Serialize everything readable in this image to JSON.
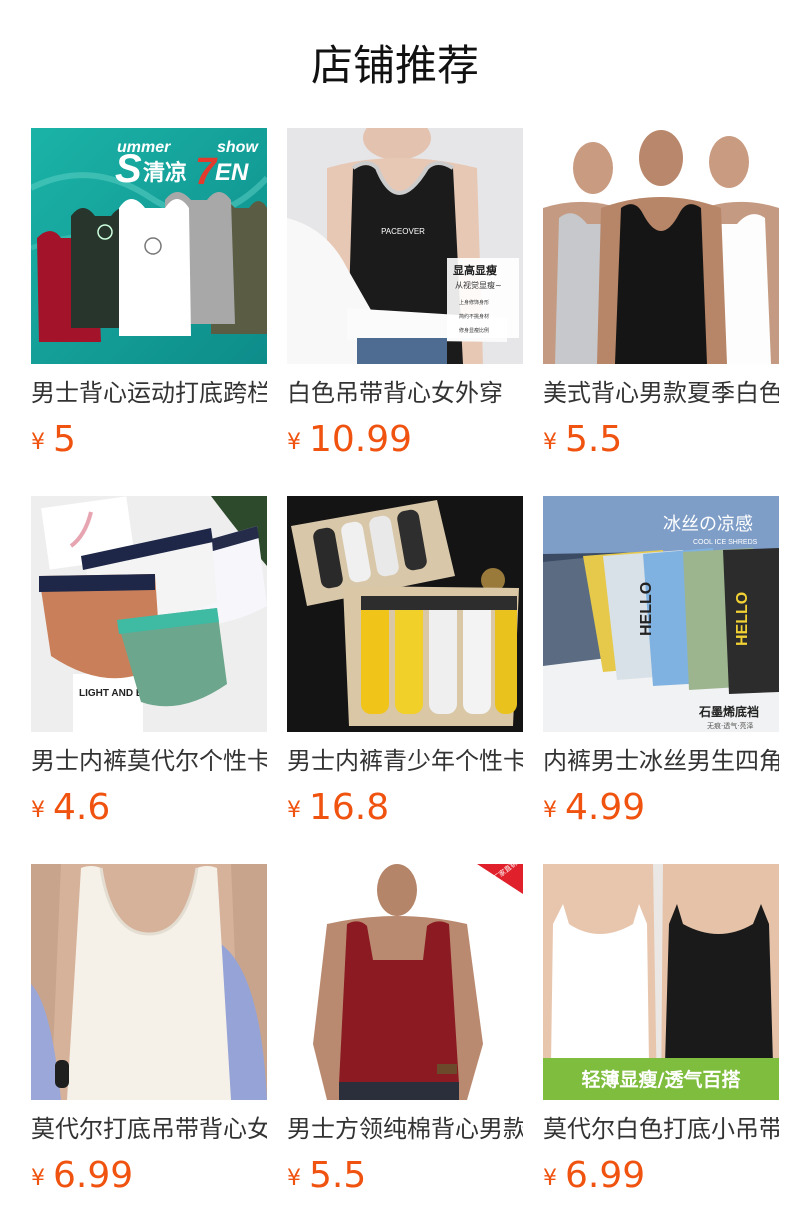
{
  "section_title": "店铺推荐",
  "currency_symbol": "¥",
  "accent_color": "#f0530f",
  "products": [
    {
      "name": "男士背心运动打底跨栏",
      "price": "5",
      "image_icon": "product-image-mens-tanks-banner",
      "image_text": {
        "top": "ummer",
        "show": "show",
        "s": "S",
        "cn": "清凉",
        "seven": "7",
        "en": "EN"
      }
    },
    {
      "name": "白色吊带背心女外穿",
      "price": "10.99",
      "image_icon": "product-image-womens-black-tank",
      "image_text": {
        "brand": "PACEOVER",
        "tag_title": "显高显瘦",
        "tag_sub": "从视觉显瘦~",
        "line1": "上身修饰身形",
        "line2": "简约不挑身材",
        "line3": "修身显瘦比例"
      }
    },
    {
      "name": "美式背心男款夏季白色",
      "price": "5.5",
      "image_icon": "product-image-three-men-tanks"
    },
    {
      "name": "男士内裤莫代尔个性卡通",
      "price": "4.6",
      "image_icon": "product-image-printed-briefs",
      "image_text": {
        "card": "LIGHT AND BOLD"
      }
    },
    {
      "name": "男士内裤青少年个性卡通",
      "price": "16.8",
      "image_icon": "product-image-boxer-gift-box"
    },
    {
      "name": "内裤男士冰丝男生四角",
      "price": "4.99",
      "image_icon": "product-image-ice-silk-boxers",
      "image_text": {
        "title": "冰丝の凉感",
        "sub": "COOL ICE SHREDS",
        "label": "石墨烯底裆",
        "label_sub": "无痕·透气·亮泽",
        "hello": "HELLO"
      }
    },
    {
      "name": "莫代尔打底吊带背心女",
      "price": "6.99",
      "image_icon": "product-image-white-ribbed-tank"
    },
    {
      "name": "男士方领纯棉背心男款",
      "price": "5.5",
      "image_icon": "product-image-red-square-neck-tank",
      "image_text": {
        "ribbon": "厂家直销"
      }
    },
    {
      "name": "莫代尔白色打底小吊带",
      "price": "6.99",
      "image_icon": "product-image-camisoles",
      "image_text": {
        "banner": "轻薄显瘦/透气百搭"
      }
    }
  ]
}
